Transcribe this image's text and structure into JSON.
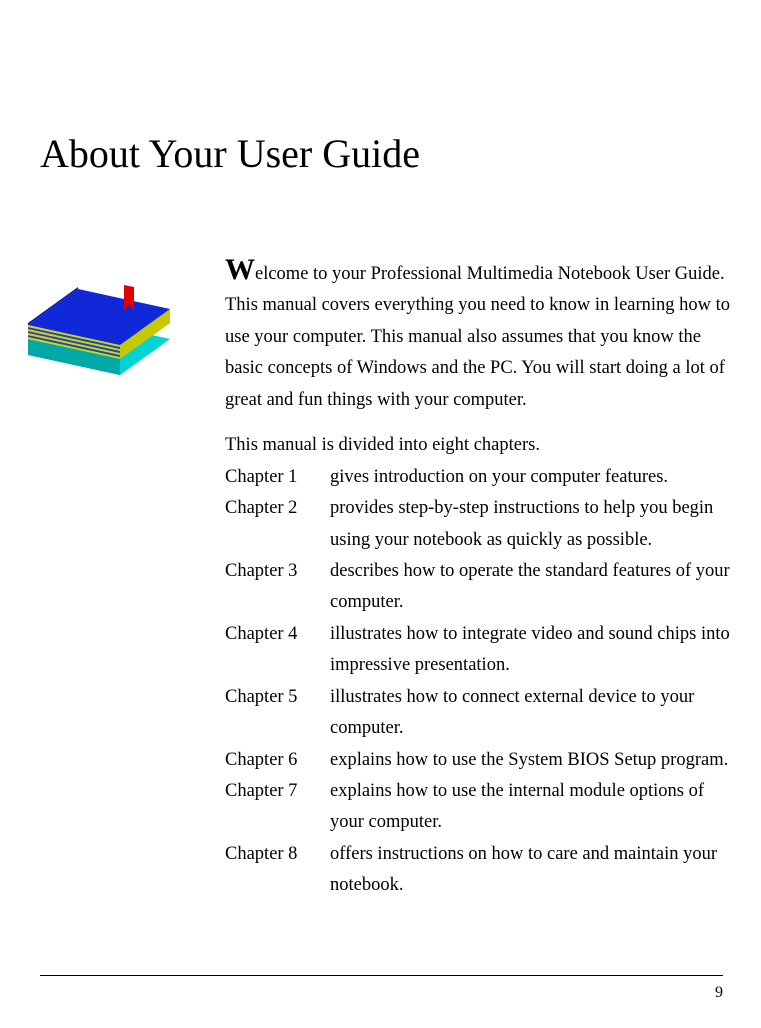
{
  "title": "About Your User Guide",
  "dropcap": "W",
  "introRest": "elcome to your Professional Multimedia Notebook User Guide. This manual covers everything you need to know in learning how to use your computer. This manual also assumes that you know the basic concepts of Windows and the PC. You will start doing a lot of great and fun things with your computer.",
  "dividerText": "This manual is divided into eight chapters.",
  "chapters": [
    {
      "label": "Chapter 1",
      "desc": "gives introduction on your computer features."
    },
    {
      "label": "Chapter 2",
      "desc": "provides step-by-step instructions to help you begin using your notebook as quickly as possible."
    },
    {
      "label": "Chapter 3",
      "desc": "describes how to operate the standard features of your computer."
    },
    {
      "label": "Chapter 4",
      "desc": "illustrates how to integrate video and sound chips into impressive presentation."
    },
    {
      "label": "Chapter 5",
      "desc": "illustrates how to connect external device to your computer."
    },
    {
      "label": "Chapter 6",
      "desc": "explains how to use the System BIOS Setup program."
    },
    {
      "label": "Chapter 7",
      "desc": "explains how to use the internal module options of your computer."
    },
    {
      "label": "Chapter 8",
      "desc": "offers instructions on how to care and maintain your notebook."
    }
  ],
  "pageNumber": "9"
}
